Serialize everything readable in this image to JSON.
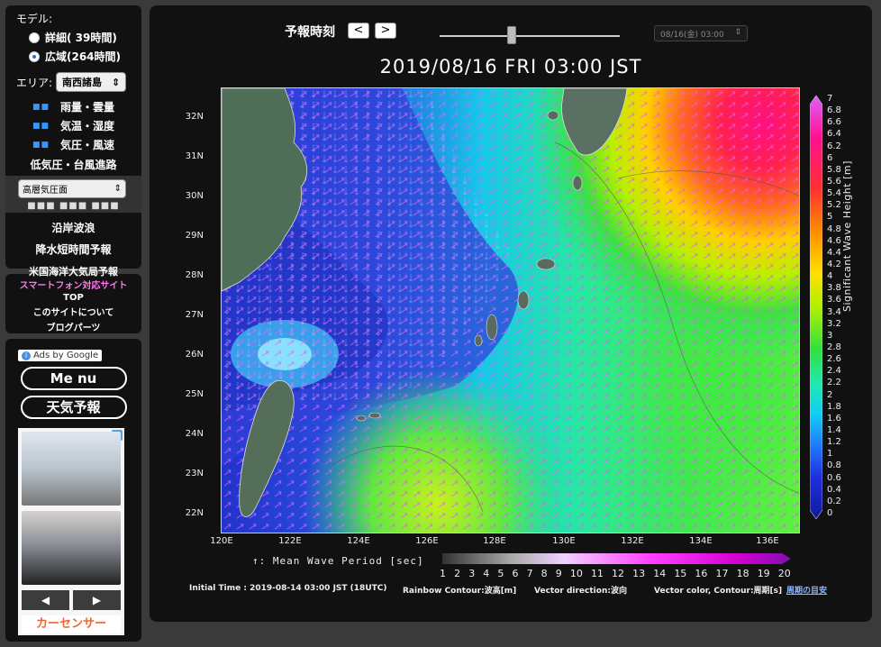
{
  "sidebar": {
    "model_label": "モデル:",
    "model_options": [
      {
        "label": "詳細( 39時間)",
        "selected": false
      },
      {
        "label": "広域(264時間)",
        "selected": true
      }
    ],
    "area_label": "エリア:",
    "area_value": "南西諸島",
    "menu": [
      "雨量・雲量",
      "気温・湿度",
      "気圧・風速"
    ],
    "typhoon_link": "低気圧・台風進路",
    "upper_select": "高層気圧面",
    "upper_dots": "■■■ ■■■ ■■■",
    "links": [
      "沿岸波浪",
      "降水短時間予報",
      "米国海洋大気局予報"
    ],
    "smartphone": "スマートフォン対応サイト",
    "top": "TOP",
    "about": "このサイトについて",
    "blog_parts": "ブログパーツ",
    "ads_by": "Ads by Google",
    "ad_menu": "Me nu",
    "ad_weather": "天気予報",
    "ad_prev": "◀",
    "ad_next": "▶",
    "ad_brand": "カーセンサー"
  },
  "header": {
    "forecast_label": "予報時刻",
    "prev": "<",
    "next": ">",
    "datetime_select": "08/16(金) 03:00",
    "title": "2019/08/16  FRI  03:00 JST"
  },
  "axes": {
    "lat_ticks": [
      "32N",
      "31N",
      "30N",
      "29N",
      "28N",
      "27N",
      "26N",
      "25N",
      "24N",
      "23N",
      "22N"
    ],
    "lon_ticks": [
      "120E",
      "122E",
      "124E",
      "126E",
      "128E",
      "130E",
      "132E",
      "134E",
      "136E"
    ]
  },
  "colorbar": {
    "title": "Significant Wave Height [m]",
    "ticks": [
      "7",
      "6.8",
      "6.6",
      "6.4",
      "6.2",
      "6",
      "5.8",
      "5.6",
      "5.4",
      "5.2",
      "5",
      "4.8",
      "4.6",
      "4.4",
      "4.2",
      "4",
      "3.8",
      "3.6",
      "3.4",
      "3.2",
      "3",
      "2.8",
      "2.6",
      "2.4",
      "2.2",
      "2",
      "1.8",
      "1.6",
      "1.4",
      "1.2",
      "1",
      "0.8",
      "0.6",
      "0.4",
      "0.2",
      "0"
    ]
  },
  "period": {
    "label": "↑: Mean Wave Period [sec]",
    "ticks": [
      "1",
      "2",
      "3",
      "4",
      "5",
      "6",
      "7",
      "8",
      "9",
      "10",
      "11",
      "12",
      "13",
      "14",
      "15",
      "16",
      "17",
      "18",
      "19",
      "20"
    ]
  },
  "footer": {
    "initial_time": "Initial Time : 2019-08-14 03:00 JST (18UTC)",
    "rainbow": "Rainbow Contour:波高[m]",
    "vector_dir": "Vector direction:波向",
    "vector_color": "Vector color, Contour:周期[s]",
    "guide_link": "周期の目安"
  }
}
